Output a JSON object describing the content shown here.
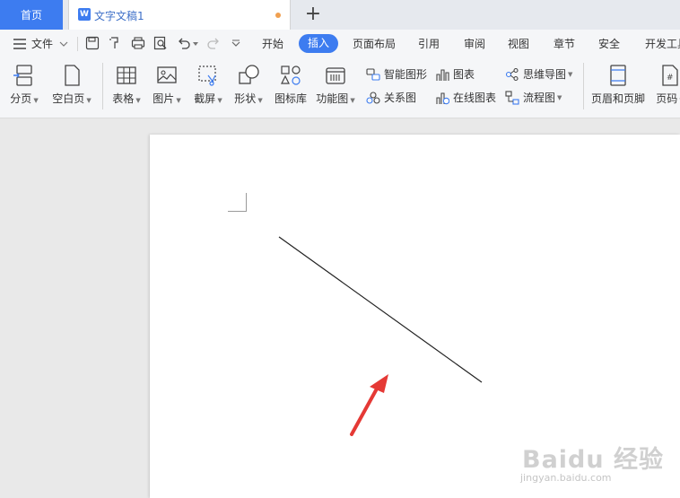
{
  "tabs": {
    "home": "首页",
    "doc_title": "文字文稿1",
    "doc_icon": "W"
  },
  "menu": {
    "file": "文件",
    "items": [
      "开始",
      "插入",
      "页面布局",
      "引用",
      "审阅",
      "视图",
      "章节",
      "安全",
      "开发工具"
    ],
    "active": "插入"
  },
  "ribbon": {
    "page_break": "分页",
    "blank_page": "空白页",
    "table": "表格",
    "picture": "图片",
    "screenshot": "截屏",
    "shape": "形状",
    "icon_library": "图标库",
    "function_chart": "功能图",
    "smart_art": "智能图形",
    "relation_chart": "关系图",
    "chart": "图表",
    "online_chart": "在线图表",
    "mind_map": "思维导图",
    "flowchart": "流程图",
    "header_footer": "页眉和页脚",
    "page_number": "页码"
  },
  "watermark": {
    "brand": "Baidu 经验",
    "url": "jingyan.baidu.com"
  },
  "colors": {
    "accent": "#3d7cf0",
    "arrow": "#e53935"
  }
}
